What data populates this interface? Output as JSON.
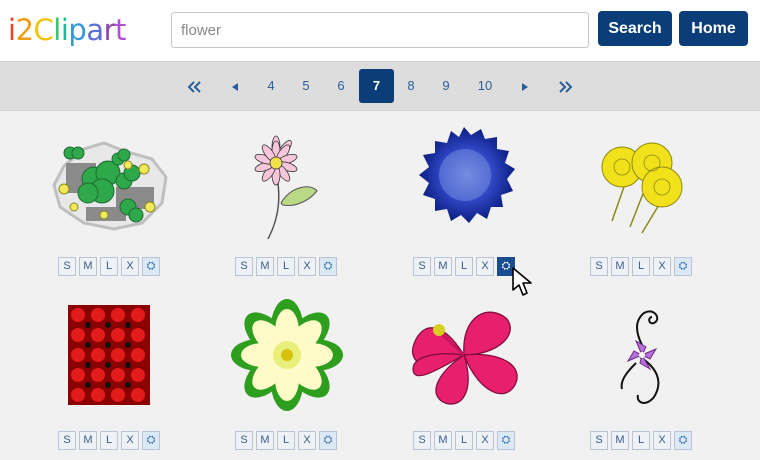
{
  "header": {
    "logo_letters": [
      {
        "ch": "i",
        "color": "#e8452c"
      },
      {
        "ch": "2",
        "color": "#f39c12"
      },
      {
        "ch": "C",
        "color": "#f1c40f"
      },
      {
        "ch": "l",
        "color": "#2ecc71"
      },
      {
        "ch": "i",
        "color": "#1abc9c"
      },
      {
        "ch": "p",
        "color": "#3498db"
      },
      {
        "ch": "a",
        "color": "#5b6fd6"
      },
      {
        "ch": "r",
        "color": "#8e44ad"
      },
      {
        "ch": "t",
        "color": "#b04fd0"
      }
    ],
    "search_value": "flower",
    "search_button": "Search",
    "home_button": "Home"
  },
  "pagination": {
    "first_icon": "double-chevron-left-icon",
    "prev_icon": "triangle-left-icon",
    "pages": [
      "4",
      "5",
      "6",
      "7",
      "8",
      "9",
      "10"
    ],
    "current": "7",
    "next_icon": "triangle-right-icon",
    "last_icon": "double-chevron-right-icon"
  },
  "size_buttons": [
    "S",
    "M",
    "L",
    "X"
  ],
  "gear_icon": "gear-icon",
  "cliparts": [
    {
      "name": "clover-collage"
    },
    {
      "name": "pink-daisy-stem"
    },
    {
      "name": "blue-cornflower"
    },
    {
      "name": "yellow-flower-bunch"
    },
    {
      "name": "red-flower-pattern"
    },
    {
      "name": "white-daisy-green"
    },
    {
      "name": "pink-hibiscus"
    },
    {
      "name": "swirl-purple-flower"
    }
  ],
  "colors": {
    "accent": "#0b3e78",
    "pager_bar": "#dddddd",
    "content_bg": "#f1f1f1"
  }
}
